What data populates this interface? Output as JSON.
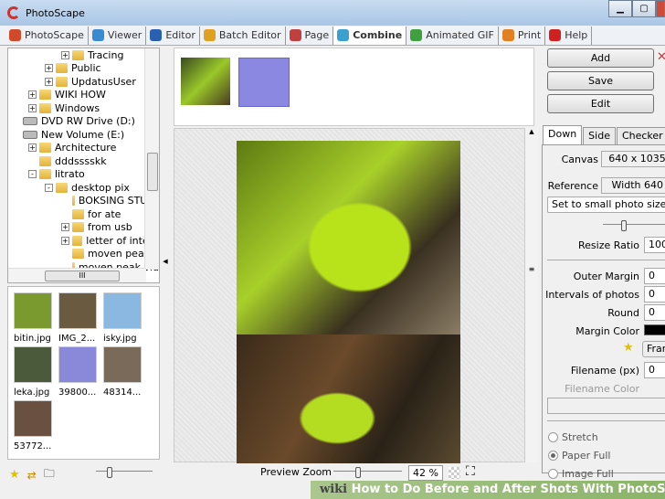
{
  "window": {
    "title": "PhotoScape"
  },
  "tabs": [
    {
      "label": "PhotoScape",
      "color": "#d04a2a"
    },
    {
      "label": "Viewer",
      "color": "#3a8ad0"
    },
    {
      "label": "Editor",
      "color": "#2a60b0"
    },
    {
      "label": "Batch Editor",
      "color": "#e0a020"
    },
    {
      "label": "Page",
      "color": "#c04040"
    },
    {
      "label": "Combine",
      "color": "#3aa0d0",
      "active": true
    },
    {
      "label": "Animated GIF",
      "color": "#40a040"
    },
    {
      "label": "Print",
      "color": "#e08020"
    },
    {
      "label": "Help",
      "color": "#d02020"
    }
  ],
  "tree": [
    {
      "label": "Tracing",
      "indent": 3,
      "type": "folder",
      "exp": "+"
    },
    {
      "label": "Public",
      "indent": 2,
      "type": "folder",
      "exp": "+"
    },
    {
      "label": "UpdatusUser",
      "indent": 2,
      "type": "folder",
      "exp": "+"
    },
    {
      "label": "WIKI HOW",
      "indent": 1,
      "type": "folder",
      "exp": "+"
    },
    {
      "label": "Windows",
      "indent": 1,
      "type": "folder",
      "exp": "+"
    },
    {
      "label": "DVD RW Drive (D:)",
      "indent": 0,
      "type": "drive"
    },
    {
      "label": "New Volume (E:)",
      "indent": 0,
      "type": "drive"
    },
    {
      "label": "Architecture",
      "indent": 1,
      "type": "folder",
      "exp": "+"
    },
    {
      "label": "dddsssskk",
      "indent": 1,
      "type": "folder"
    },
    {
      "label": "litrato",
      "indent": 1,
      "type": "folder",
      "exp": "-"
    },
    {
      "label": "desktop pix",
      "indent": 2,
      "type": "folder",
      "exp": "-"
    },
    {
      "label": "BOKSING STUFF",
      "indent": 3,
      "type": "folder"
    },
    {
      "label": "for ate",
      "indent": 3,
      "type": "folder"
    },
    {
      "label": "from usb",
      "indent": 3,
      "type": "folder",
      "exp": "+"
    },
    {
      "label": "letter of intent",
      "indent": 3,
      "type": "folder",
      "exp": "+"
    },
    {
      "label": "moven peak",
      "indent": 3,
      "type": "folder"
    },
    {
      "label": "moven peak vid",
      "indent": 3,
      "type": "folder"
    }
  ],
  "hscroll_grip": "III",
  "thumbnails": [
    {
      "label": "bitin.jpg",
      "color": "#7a9a30"
    },
    {
      "label": "IMG_2...",
      "color": "#6a5a40"
    },
    {
      "label": "isky.jpg",
      "color": "#8ab8e0"
    },
    {
      "label": "leka.jpg",
      "color": "#4a5a3a"
    },
    {
      "label": "39800...",
      "color": "#8a88d8"
    },
    {
      "label": "48314...",
      "color": "#7a6a5a"
    },
    {
      "label": "53772...",
      "color": "#6a5040"
    }
  ],
  "preview": {
    "zoom_label": "Preview Zoom",
    "zoom_value": "42 %"
  },
  "buttons": {
    "add": "Add",
    "save": "Save",
    "edit": "Edit"
  },
  "panel": {
    "tabs": [
      "Down",
      "Side",
      "Checker"
    ],
    "canvas_label": "Canvas",
    "canvas_value": "640 x 1035",
    "reference_label": "Reference",
    "reference_value": "Width 640",
    "size_select": "Set to small photo size",
    "resize_label": "Resize Ratio",
    "resize_value": "100",
    "outer_margin_label": "Outer Margin",
    "outer_margin_value": "0",
    "intervals_label": "Intervals of photos",
    "intervals_value": "0",
    "round_label": "Round",
    "round_value": "0",
    "margin_color_label": "Margin Color",
    "margin_color": "#000000",
    "frame_label": "Fran",
    "filename_label": "Filename (px)",
    "filename_value": "0",
    "filename_color_label": "Filename Color",
    "radios": [
      {
        "label": "Stretch",
        "checked": false
      },
      {
        "label": "Paper Full",
        "checked": true
      },
      {
        "label": "Image Full",
        "checked": false
      }
    ]
  },
  "watermark": {
    "brand": "wiki",
    "text": "How to Do Before and After Shots With PhotoScape"
  }
}
